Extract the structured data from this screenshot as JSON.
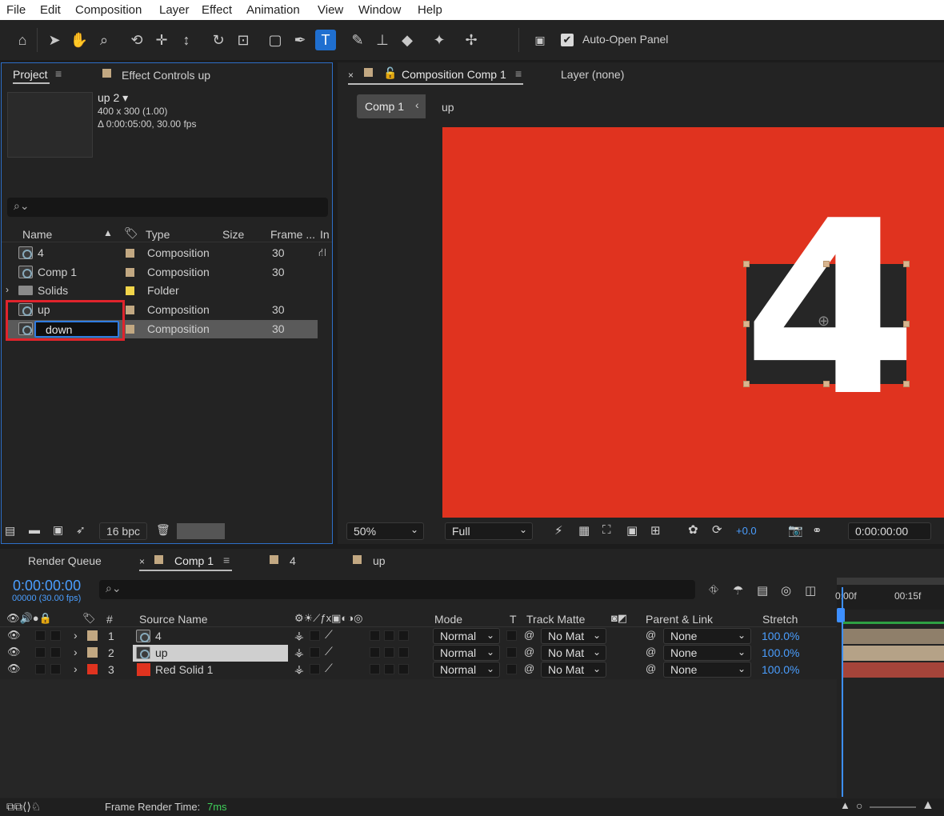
{
  "menu": [
    "File",
    "Edit",
    "Composition",
    "Layer",
    "Effect",
    "Animation",
    "View",
    "Window",
    "Help"
  ],
  "toolbar": {
    "auto_open_label": "Auto-Open Panel"
  },
  "project": {
    "tab_label": "Project",
    "effect_controls_label": "Effect Controls up",
    "preview": {
      "name": "up 2",
      "dims": "400 x 300 (1.00)",
      "duration": "Δ 0:00:05:00, 30.00 fps"
    },
    "search_placeholder": "",
    "columns": {
      "name": "Name",
      "type": "Type",
      "size": "Size",
      "frame": "Frame ...",
      "in": "In"
    },
    "items": [
      {
        "name": "4",
        "type": "Composition",
        "frame": "30",
        "label_color": "#c2a882"
      },
      {
        "name": "Comp 1",
        "type": "Composition",
        "frame": "30",
        "label_color": "#c2a882"
      },
      {
        "name": "Solids",
        "type": "Folder",
        "frame": "",
        "label_color": "#f2d54a"
      },
      {
        "name": "up",
        "type": "Composition",
        "frame": "30",
        "label_color": "#c2a882"
      },
      {
        "name": "down",
        "type": "Composition",
        "frame": "30",
        "label_color": "#c2a882"
      }
    ],
    "bpc": "16 bpc"
  },
  "comp": {
    "tab_label": "Composition Comp 1",
    "layer_label": "Layer (none)",
    "breadcrumb_current": "Comp 1",
    "breadcrumb_next": "up",
    "big_digit": "4",
    "bg_color": "#e0331f",
    "zoom": "50%",
    "resolution": "Full",
    "exposure": "+0.0",
    "timecode": "0:00:00:00"
  },
  "timeline": {
    "render_queue_label": "Render Queue",
    "tabs": [
      "Comp 1",
      "4",
      "up"
    ],
    "timecode": "0:00:00:00",
    "frames": "00000 (30.00 fps)",
    "headers": {
      "num": "#",
      "source": "Source Name",
      "mode": "Mode",
      "t": "T",
      "track_matte": "Track Matte",
      "parent": "Parent & Link",
      "stretch": "Stretch"
    },
    "ruler": {
      "start": "0:00f",
      "mark": "00:15f"
    },
    "layers": [
      {
        "num": "1",
        "name": "4",
        "mode": "Normal",
        "matte": "No Mat",
        "parent": "None",
        "stretch": "100.0%",
        "label_color": "#c2a882"
      },
      {
        "num": "2",
        "name": "up",
        "mode": "Normal",
        "matte": "No Mat",
        "parent": "None",
        "stretch": "100.0%",
        "label_color": "#c2a882"
      },
      {
        "num": "3",
        "name": "Red Solid 1",
        "mode": "Normal",
        "matte": "No Mat",
        "parent": "None",
        "stretch": "100.0%",
        "label_color": "#e0331f"
      }
    ],
    "render_time_label": "Frame Render Time:",
    "render_time_value": "7ms"
  }
}
